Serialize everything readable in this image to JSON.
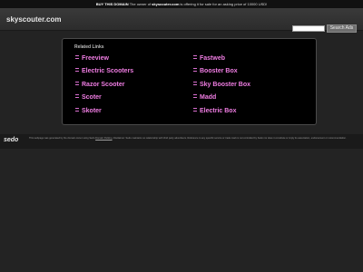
{
  "top_bar": {
    "label": "BUY THIS DOMAIN",
    "text_pre": "The owner of ",
    "domain": "skyscouter.com",
    "text_post": " is offering it for sale for an asking price of 10000 USD!"
  },
  "header": {
    "site_title": "skyscouter.com",
    "search_value": "",
    "search_button": "Search Ads"
  },
  "related": {
    "heading": "Related Links",
    "left_links": [
      "Freeview",
      "Electric Scooters",
      "Razor Scooter",
      "Scoter",
      "Skoter"
    ],
    "right_links": [
      "Fastweb",
      "Booster Box",
      "Sky Booster Box",
      "Madd",
      "Electric Box"
    ]
  },
  "footer": {
    "logo": "sedo",
    "text_1": "This webpage was generated by the domain owner using Sedo ",
    "link": "Domain Parking",
    "text_2": ". Disclaimer: Sedo maintains no relationship with third party advertisers. Reference to any specific service or trade mark is not controlled by Sedo nor does it constitute or imply its association, endorsement or recommendation."
  },
  "colors": {
    "link": "#f07de3",
    "background": "#232323",
    "panel": "#000000"
  }
}
